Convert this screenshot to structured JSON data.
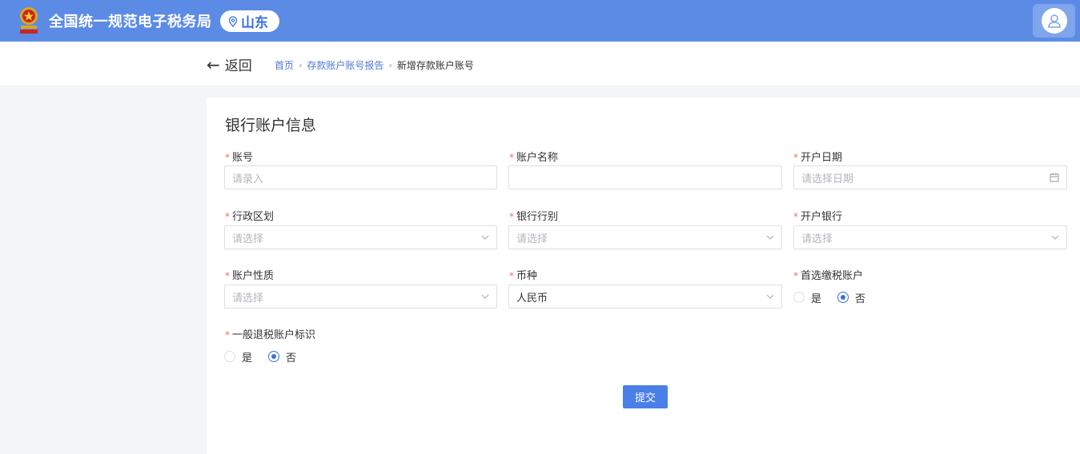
{
  "header": {
    "site_title": "全国统一规范电子税务局",
    "region": "山东"
  },
  "nav": {
    "back_label": "返回",
    "breadcrumb": [
      "首页",
      "存款账户账号报告",
      "新增存款账户账号"
    ]
  },
  "form": {
    "section_title": "银行账户信息",
    "required_mark": "*",
    "fields": {
      "account_no": {
        "label": "账号",
        "placeholder": "请录入"
      },
      "account_name": {
        "label": "账户名称",
        "value": ""
      },
      "open_date": {
        "label": "开户日期",
        "placeholder": "请选择日期"
      },
      "admin_region": {
        "label": "行政区划",
        "placeholder": "请选择"
      },
      "bank_type": {
        "label": "银行行别",
        "placeholder": "请选择"
      },
      "open_bank": {
        "label": "开户银行",
        "placeholder": "请选择"
      },
      "account_nature": {
        "label": "账户性质",
        "placeholder": "请选择"
      },
      "currency": {
        "label": "币种",
        "value": "人民币"
      },
      "preferred_tax_account": {
        "label": "首选缴税账户",
        "options": [
          "是",
          "否"
        ],
        "selected": "否"
      },
      "refund_account_flag": {
        "label": "一般退税账户标识",
        "options": [
          "是",
          "否"
        ],
        "selected": "否"
      }
    },
    "submit_label": "提交"
  },
  "colors": {
    "header_bg": "#5c8be6",
    "primary": "#3a6fe0",
    "required": "#f56c6c"
  }
}
